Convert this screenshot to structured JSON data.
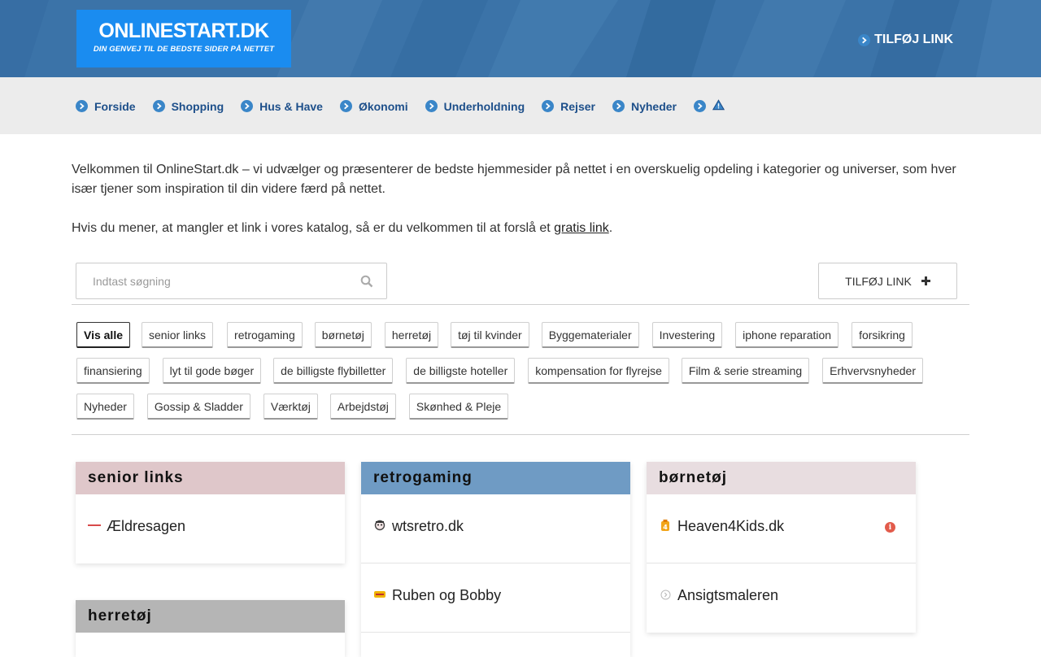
{
  "header": {
    "logo_title": "ONLINESTART.DK",
    "logo_tagline": "DIN GENVEJ TIL DE BEDSTE SIDER PÅ NETTET",
    "add_link_label": "TILFØJ LINK"
  },
  "nav": {
    "items": [
      {
        "label": "Forside"
      },
      {
        "label": "Shopping"
      },
      {
        "label": "Hus & Have"
      },
      {
        "label": "Økonomi"
      },
      {
        "label": "Underholdning"
      },
      {
        "label": "Rejser"
      },
      {
        "label": "Nyheder"
      }
    ],
    "warning_icon": "warning-triangle-icon"
  },
  "intro": {
    "paragraph1": "Velkommen til OnlineStart.dk – vi udvælger og præsenterer de bedste hjemmesider på nettet i en overskuelig opdeling i kategorier og universer, som hver især tjener som inspiration til din videre færd på nettet.",
    "paragraph2_before": "Hvis du mener, at mangler et link i vores katalog, så er du velkommen til at forslå et ",
    "paragraph2_link": "gratis link",
    "paragraph2_after": "."
  },
  "search": {
    "placeholder": "Indtast søgning",
    "value": ""
  },
  "add_button": {
    "label": "TILFØJ LINK"
  },
  "tags": {
    "row1": [
      "Vis alle",
      "senior links",
      "retrogaming",
      "børnetøj",
      "herretøj",
      "tøj til kvinder",
      "Byggematerialer",
      "Investering",
      "iphone reparation",
      "forsikring"
    ],
    "row2": [
      "finansiering",
      "lyt til gode bøger",
      "de billigste flybilletter",
      "de billigste hoteller",
      "kompensation for flyrejse",
      "Film & serie streaming",
      "Erhvervsnyheder"
    ],
    "row3": [
      "Nyheder",
      "Gossip & Sladder",
      "Værktøj",
      "Arbejdstøj",
      "Skønhed & Pleje"
    ],
    "active": "Vis alle"
  },
  "cards": {
    "senior": {
      "title": "senior links",
      "color": "#dfc7ca",
      "items": [
        "Ældresagen"
      ]
    },
    "retro": {
      "title": "retrogaming",
      "color": "#6f9bc4",
      "items": [
        "wtsretro.dk",
        "Ruben og Bobby"
      ]
    },
    "born": {
      "title": "børnetøj",
      "color": "#e8dde0",
      "items": [
        "Heaven4Kids.dk",
        "Ansigtsmaleren"
      ]
    },
    "herre": {
      "title": "herretøj",
      "color": "#b5b5b5",
      "items": []
    }
  },
  "colors": {
    "header_bg": "#3b73a8",
    "logo_bg": "#1a8cf0",
    "nav_bg": "#ececec",
    "nav_text": "#1d4f8a",
    "arrow_accent": "#3a86c8",
    "info_badge": "#e25b4b"
  }
}
